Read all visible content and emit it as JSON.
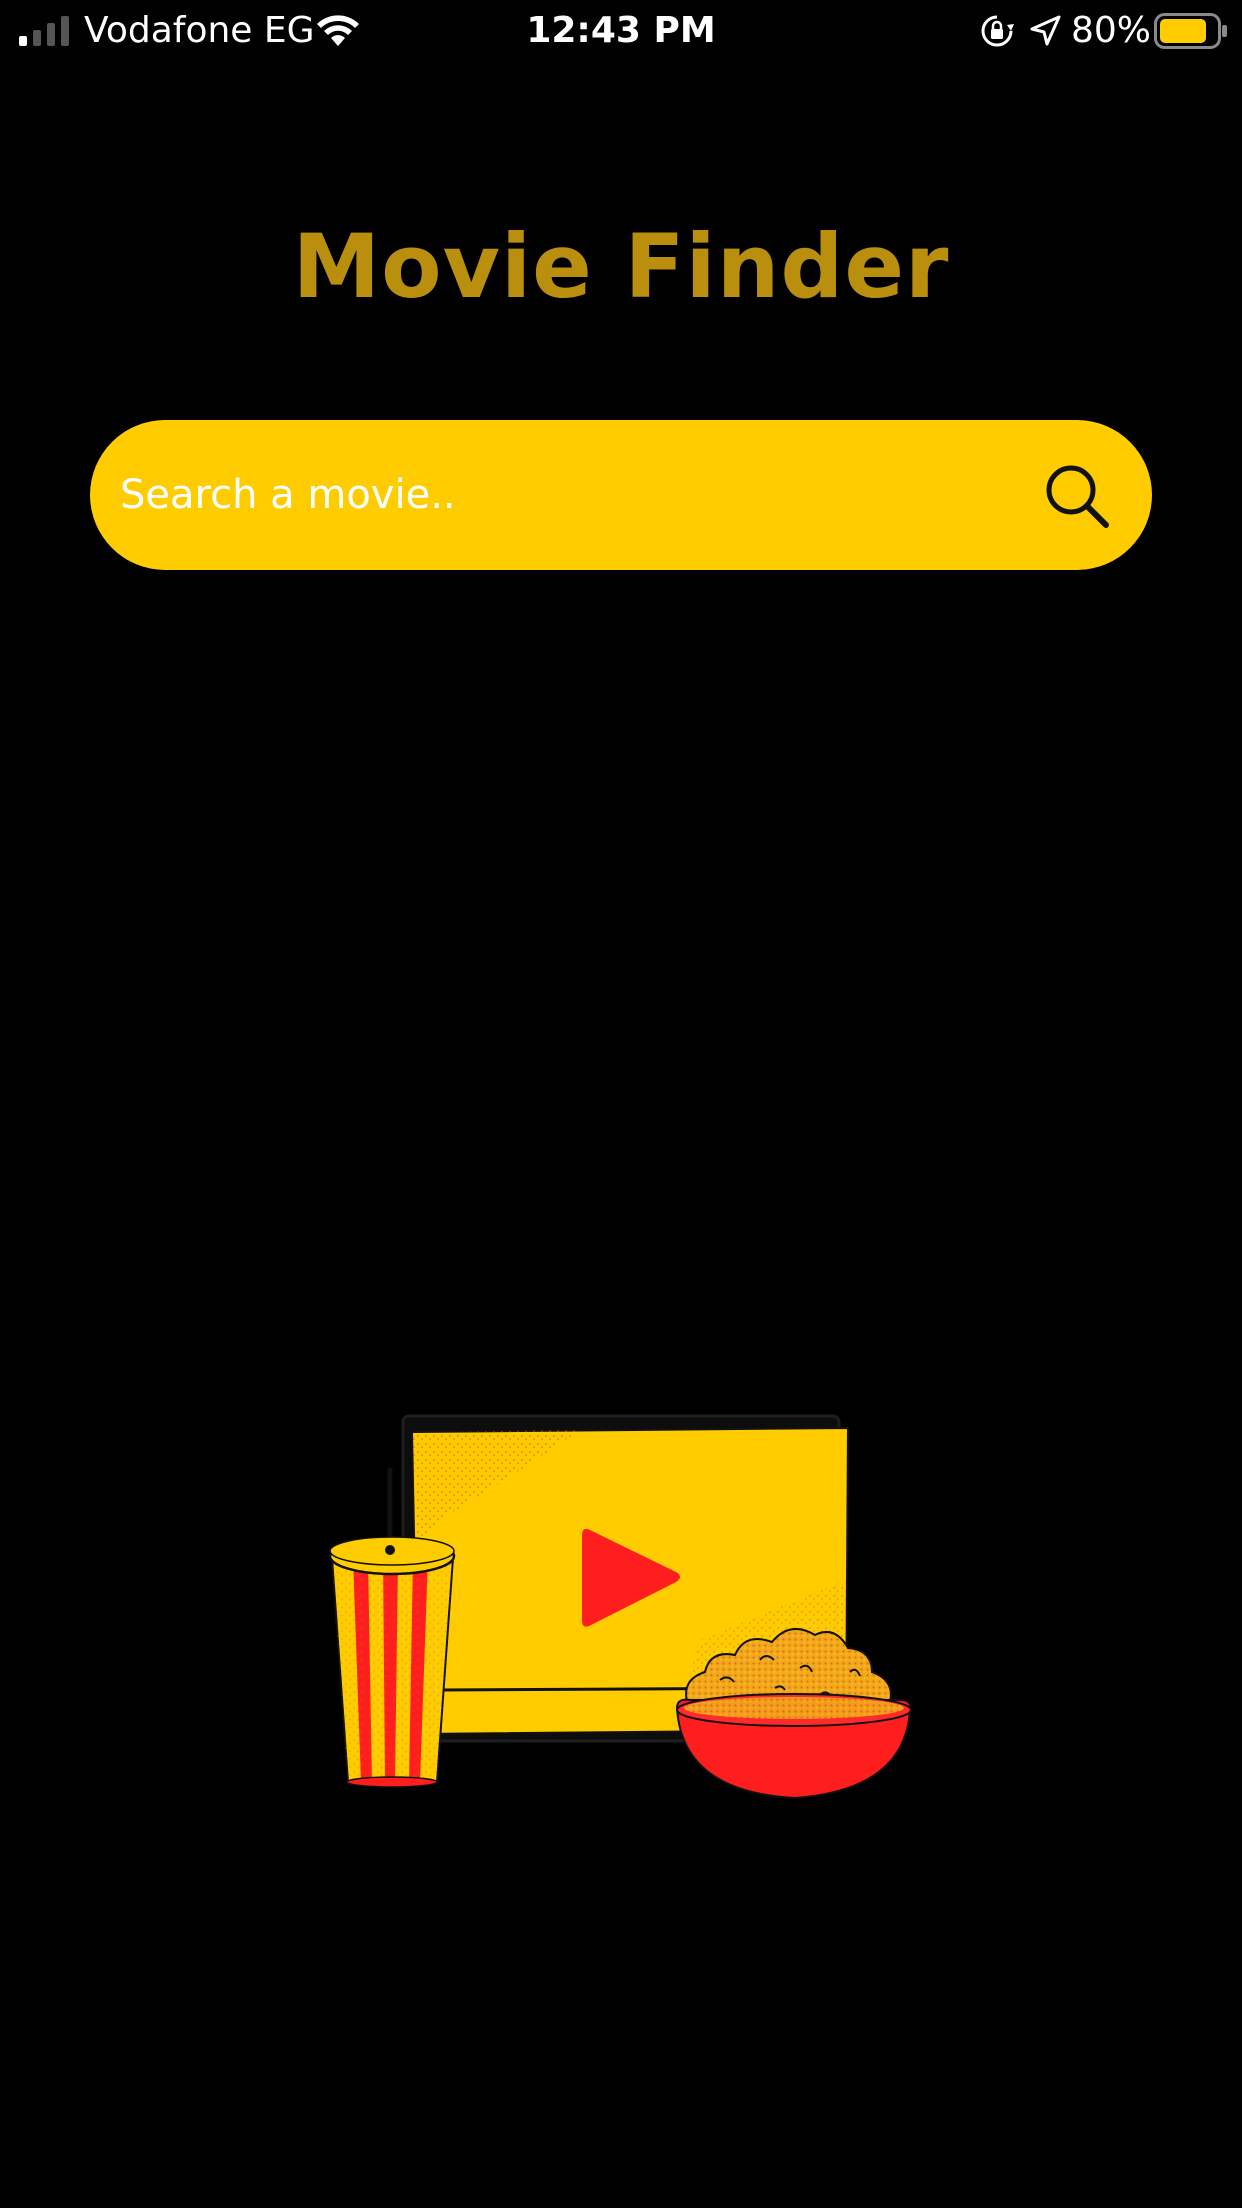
{
  "status_bar": {
    "carrier": "Vodafone EG",
    "time": "12:43 PM",
    "battery_percent": "80%",
    "signal_icon": "cellular-signal-icon",
    "wifi_icon": "wifi-icon",
    "rotation_lock_icon": "rotation-lock-icon",
    "location_icon": "location-arrow-icon",
    "battery_icon": "battery-icon",
    "battery_level": 0.8
  },
  "header": {
    "title": "Movie Finder"
  },
  "search": {
    "placeholder": "Search a movie..",
    "value": "",
    "icon": "search-icon"
  },
  "illustration": {
    "name": "movie-snacks-illustration"
  },
  "colors": {
    "background": "#000000",
    "title": "#b98f0d",
    "accent": "#ffcc00",
    "red": "#ff1e1e",
    "text": "#ffffff"
  }
}
